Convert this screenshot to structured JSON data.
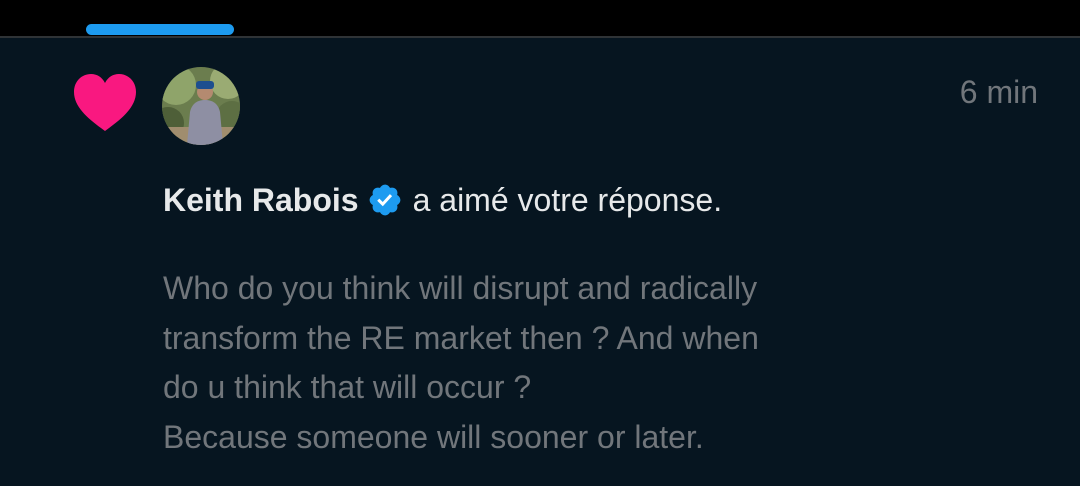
{
  "notification": {
    "time": "6 min",
    "user_name": "Keith Rabois",
    "action_text": "a aimé votre réponse.",
    "reply_lines": [
      "Who do you think will disrupt and radically",
      "transform the RE market then ? And when",
      "do u think that will occur ?",
      "Because someone will sooner or later."
    ]
  },
  "icons": {
    "notification_type": "heart-icon",
    "verified": "verified-badge-icon",
    "avatar": "avatar"
  },
  "colors": {
    "heart": "#f91880",
    "verified": "#1d9bf0",
    "tab_indicator": "#1d9bf0",
    "card_background": "#061520",
    "muted_text": "#71767b",
    "primary_text": "#e7e9ea"
  }
}
